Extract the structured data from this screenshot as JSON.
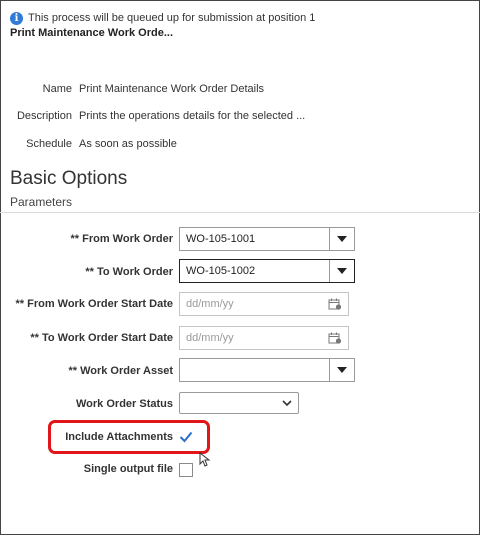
{
  "notice": {
    "text": "This process will be queued up for submission at position 1"
  },
  "process_title": "Print Maintenance Work Orde...",
  "details": {
    "name_label": "Name",
    "name_value": "Print Maintenance Work Order Details",
    "description_label": "Description",
    "description_value": "Prints the operations details for the selected ...",
    "schedule_label": "Schedule",
    "schedule_value": "As soon as possible"
  },
  "section": {
    "heading": "Basic Options",
    "subheading": "Parameters"
  },
  "params": {
    "from_wo": {
      "label": "** From Work Order",
      "value": "WO-105-1001"
    },
    "to_wo": {
      "label": "** To Work Order",
      "value": "WO-105-1002"
    },
    "from_date": {
      "label": "** From Work Order Start Date",
      "placeholder": "dd/mm/yy"
    },
    "to_date": {
      "label": "** To Work Order Start Date",
      "placeholder": "dd/mm/yy"
    },
    "asset": {
      "label": "** Work Order Asset",
      "value": ""
    },
    "status": {
      "label": "Work Order Status",
      "value": ""
    },
    "attachments": {
      "label": "Include Attachments",
      "checked": true
    },
    "single_output": {
      "label": "Single output file",
      "checked": false
    }
  },
  "colors": {
    "accent": "#2f7bd6",
    "highlight": "#e0161a",
    "check": "#2a6fc9"
  },
  "icons": [
    "info-icon",
    "chevron-down-icon",
    "calendar-icon",
    "checkmark-icon",
    "mouse-cursor-icon"
  ]
}
